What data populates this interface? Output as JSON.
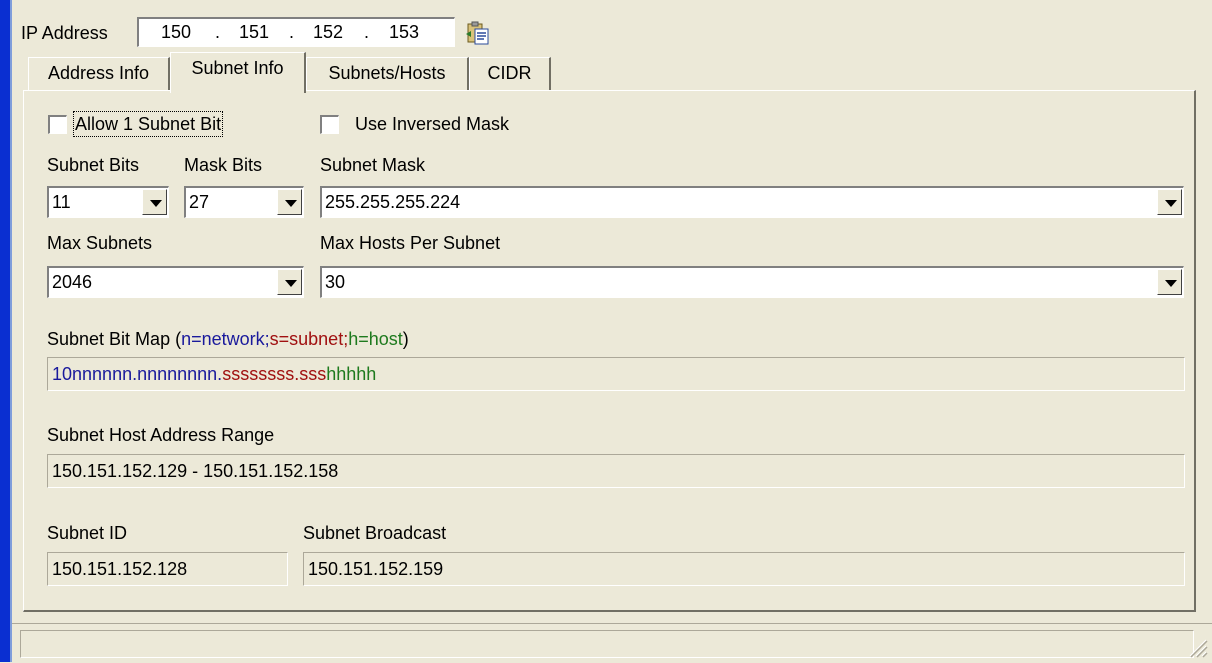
{
  "ip": {
    "label": "IP Address",
    "octets": [
      "150",
      "151",
      "152",
      "153"
    ],
    "dot": "."
  },
  "tabs": [
    {
      "label": "Address Info",
      "active": false
    },
    {
      "label": "Subnet Info",
      "active": true
    },
    {
      "label": "Subnets/Hosts",
      "active": false
    },
    {
      "label": "CIDR",
      "active": false
    }
  ],
  "options": {
    "allow_1_subnet_bit": {
      "label": "Allow 1 Subnet Bit",
      "checked": false
    },
    "use_inversed_mask": {
      "label": "Use Inversed Mask",
      "checked": false
    }
  },
  "fields": {
    "subnet_bits": {
      "label": "Subnet Bits",
      "value": "11"
    },
    "mask_bits": {
      "label": "Mask Bits",
      "value": "27"
    },
    "subnet_mask": {
      "label": "Subnet Mask",
      "value": "255.255.255.224"
    },
    "max_subnets": {
      "label": "Max Subnets",
      "value": "2046"
    },
    "max_hosts": {
      "label": "Max Hosts Per Subnet",
      "value": "30"
    }
  },
  "bitmap": {
    "label_prefix": "Subnet Bit Map (",
    "legend_network": "n=network;",
    "legend_subnet": "s=subnet;",
    "legend_host": "h=host",
    "label_suffix": ")",
    "network_part": "10nnnnnn.nnnnnnnn.",
    "subnet_part": "ssssssss.sss",
    "host_part": "hhhhh"
  },
  "range": {
    "label": "Subnet Host Address Range",
    "value": "150.151.152.129 - 150.151.152.158"
  },
  "subnet_id": {
    "label": "Subnet ID",
    "value": "150.151.152.128"
  },
  "broadcast": {
    "label": "Subnet Broadcast",
    "value": "150.151.152.159"
  },
  "colors": {
    "network": "#1a1a9c",
    "subnet": "#a01010",
    "host": "#1e7a1e",
    "window_bg": "#ece9d8",
    "frame_blue": "#0a2fd1"
  },
  "icons": {
    "copy": "clipboard-copy-icon",
    "dropdown": "chevron-down-icon",
    "grip": "resize-grip-icon"
  }
}
